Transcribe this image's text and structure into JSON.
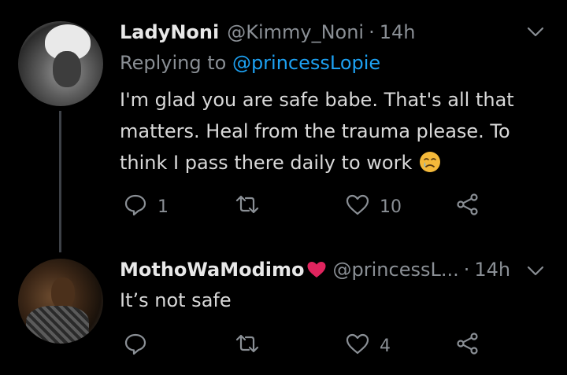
{
  "tweets": [
    {
      "name": "LadyNoni",
      "handle": "@Kimmy_Noni",
      "dot": "·",
      "time": "14h",
      "replying_prefix": "Replying to ",
      "replying_to": "@princessLopie",
      "text": "I'm glad you are safe babe. That's all that matters. Heal from the trauma please. To think I pass there daily to work",
      "reply_count": "1",
      "retweet_count": "",
      "like_count": "10"
    },
    {
      "name": "MothoWaModimo",
      "handle": "@princessL...",
      "dot": "·",
      "time": "14h",
      "text": "It’s not safe",
      "reply_count": "",
      "retweet_count": "",
      "like_count": "4"
    }
  ],
  "icons": {
    "reply": "reply-icon",
    "retweet": "retweet-icon",
    "like": "heart-icon",
    "share": "share-icon",
    "more": "chevron-down-icon",
    "emoji_1": "crying-face-emoji",
    "emoji_2": "red-heart-emoji"
  },
  "colors": {
    "background": "#000000",
    "text": "#d9d9d9",
    "muted": "#8a8f95",
    "link": "#1da1f2",
    "thread_line": "#3d4147",
    "heart": "#e0245e"
  }
}
